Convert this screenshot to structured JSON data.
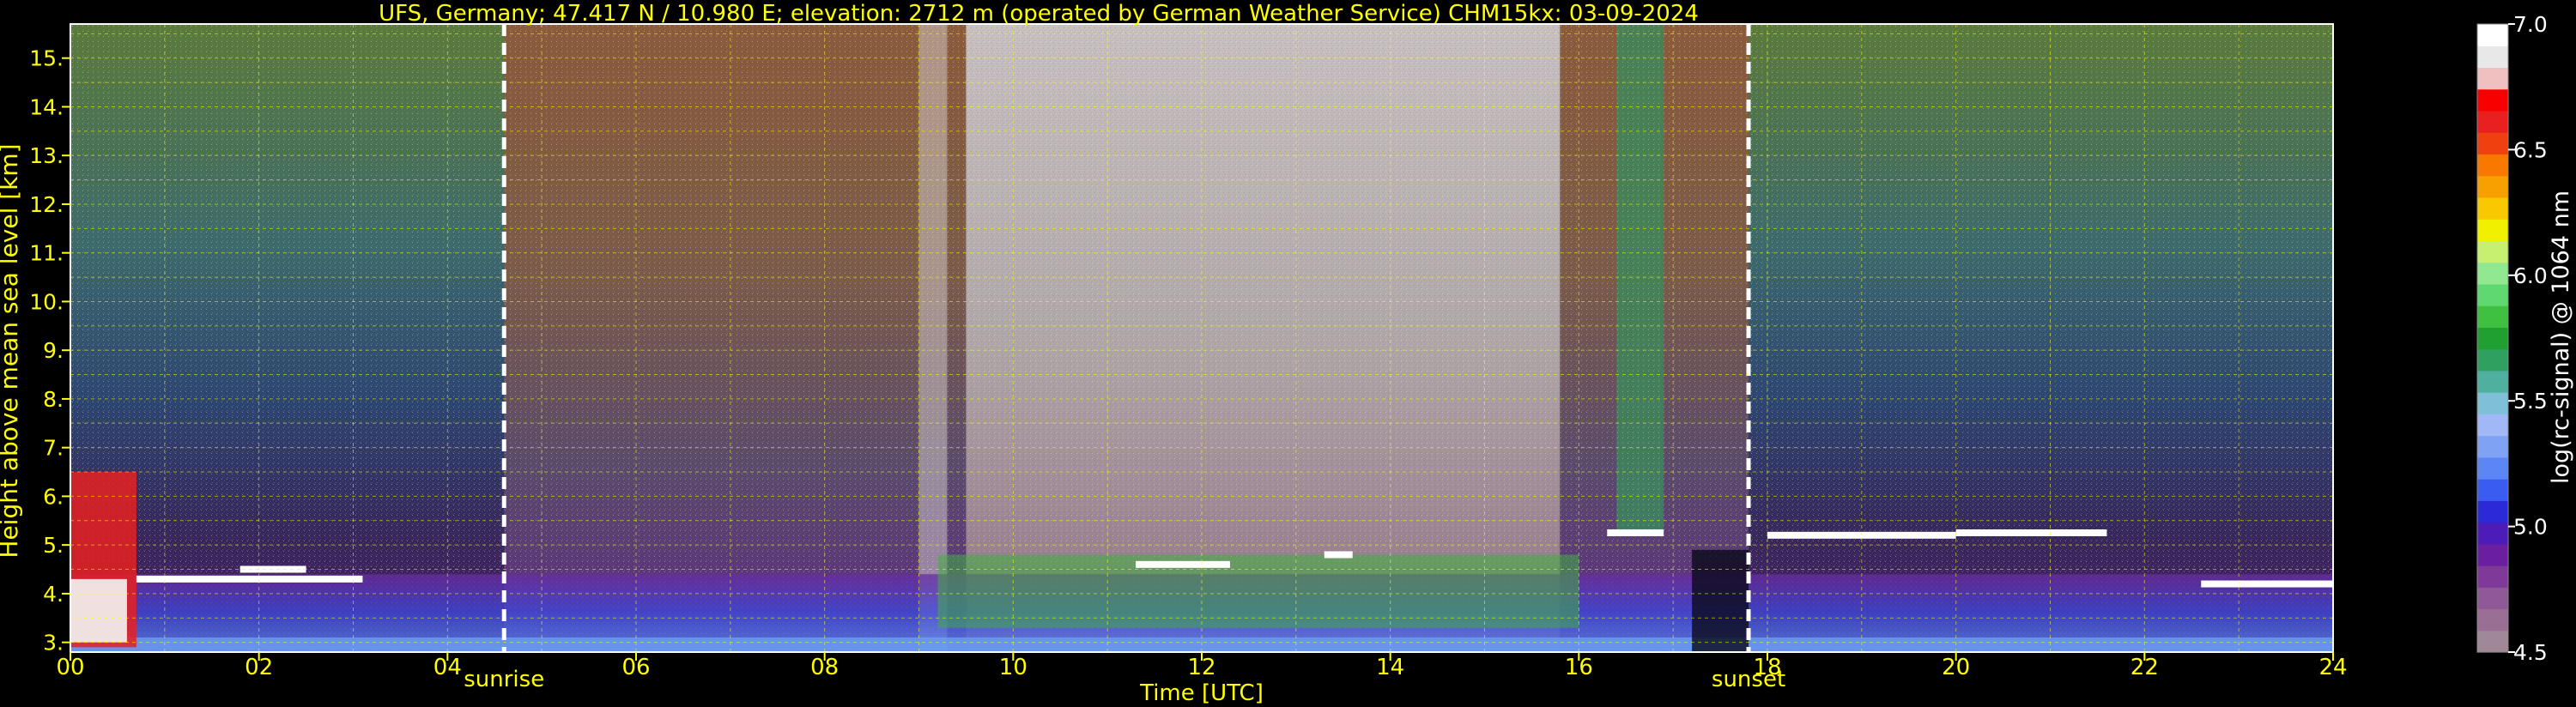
{
  "chart_data": {
    "type": "heatmap",
    "title": "UFS, Germany; 47.417 N / 10.980 E; elevation: 2712 m  (operated by German Weather Service)    CHM15kx: 03-09-2024",
    "xlabel": "Time [UTC]",
    "ylabel": "Height above mean sea level [km]",
    "x_ticks": [
      "00",
      "02",
      "04",
      "06",
      "08",
      "10",
      "12",
      "14",
      "16",
      "18",
      "20",
      "22",
      "24"
    ],
    "y_ticks": [
      "3.",
      "4.",
      "5.",
      "6.",
      "7.",
      "8.",
      "9.",
      "10.",
      "11.",
      "12.",
      "13.",
      "14.",
      "15."
    ],
    "xlim": [
      0,
      24
    ],
    "ylim": [
      2.8,
      15.7
    ],
    "grid": true,
    "annotations": [
      {
        "label": "sunrise",
        "x": 4.6
      },
      {
        "label": "sunset",
        "x": 17.8
      }
    ],
    "colorbar": {
      "label": "log(rc-signal) @ 1064 nm",
      "ticks": [
        "4.5",
        "5.0",
        "5.5",
        "6.0",
        "6.5",
        "7.0"
      ],
      "range": [
        4.5,
        7.0
      ],
      "colors": [
        "#a08898",
        "#9a6f95",
        "#8f5896",
        "#7f3a99",
        "#6a1fa0",
        "#4c1bb8",
        "#2a2ad8",
        "#3a5cf0",
        "#5c86f5",
        "#7fa2f5",
        "#a0b8f5",
        "#7fc0d8",
        "#4fb0a0",
        "#2fa060",
        "#20a030",
        "#40c040",
        "#60d870",
        "#90e890",
        "#c8f070",
        "#f0f000",
        "#f8c800",
        "#f8a000",
        "#f87800",
        "#f04010",
        "#e82020",
        "#f80000",
        "#f0c0c0",
        "#e8e8e8",
        "#ffffff"
      ]
    }
  }
}
